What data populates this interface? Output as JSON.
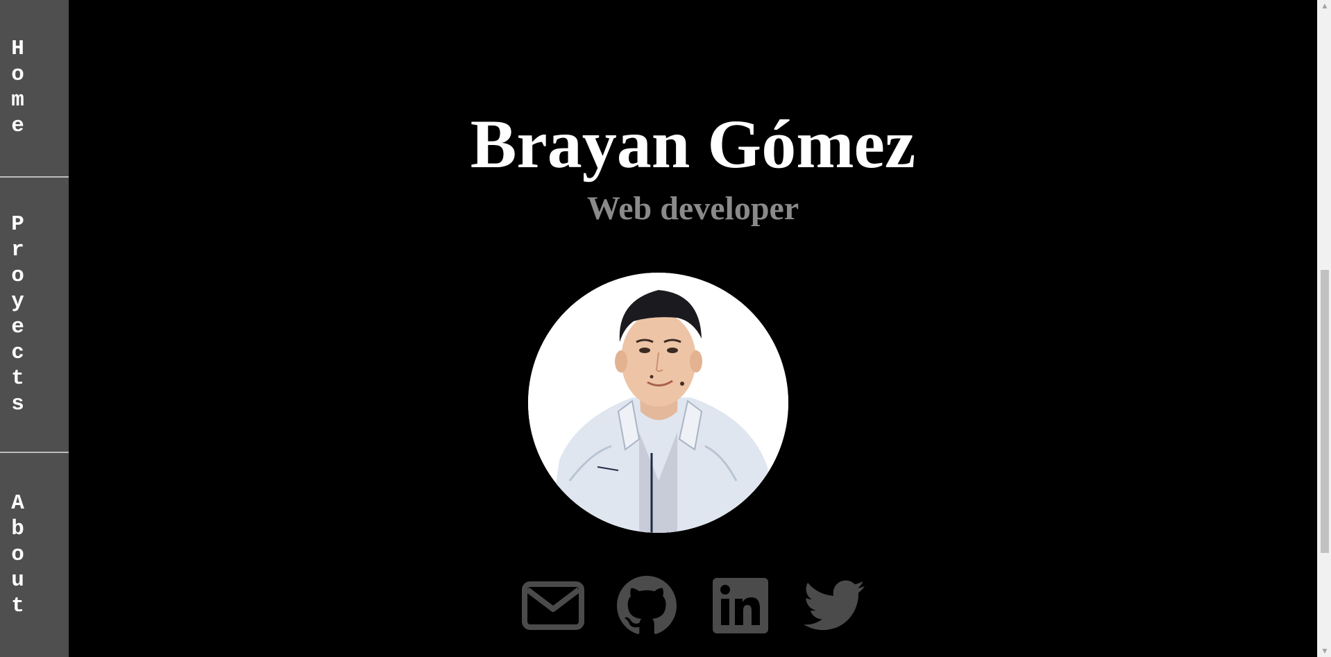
{
  "nav": {
    "items": [
      {
        "label": "Home"
      },
      {
        "label": "Proyects"
      },
      {
        "label": "About"
      }
    ]
  },
  "hero": {
    "name": "Brayan Gómez",
    "role": "Web developer"
  },
  "socials": [
    {
      "icon": "mail-icon"
    },
    {
      "icon": "github-icon"
    },
    {
      "icon": "linkedin-icon"
    },
    {
      "icon": "twitter-icon"
    }
  ],
  "colors": {
    "background": "#000000",
    "sidebar": "#4f4f4f",
    "icon": "#4b4b4b",
    "role_text": "#8a8a8a"
  }
}
